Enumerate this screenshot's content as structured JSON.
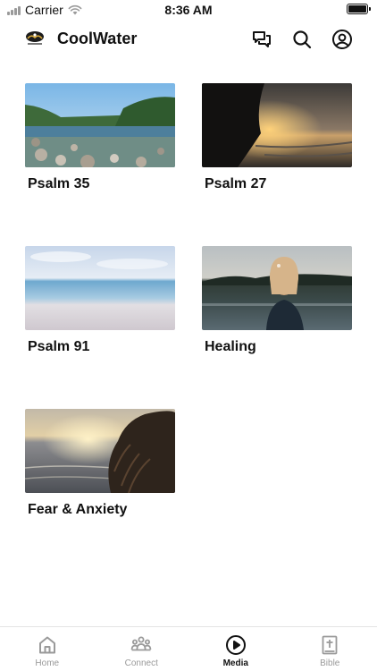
{
  "status_bar": {
    "carrier": "Carrier",
    "time": "8:36 AM"
  },
  "header": {
    "title": "CoolWater",
    "icons": [
      "chat-icon",
      "search-icon",
      "profile-icon"
    ]
  },
  "media": {
    "items": [
      {
        "title": "Psalm 35",
        "image": "rocky-lake-forest"
      },
      {
        "title": "Psalm 27",
        "image": "sunset-beach"
      },
      {
        "title": "Psalm 91",
        "image": "calm-sea-horizon"
      },
      {
        "title": "Healing",
        "image": "person-by-lake"
      },
      {
        "title": "Fear & Anxiety",
        "image": "sea-with-hair"
      }
    ]
  },
  "tab_bar": {
    "tabs": [
      {
        "label": "Home",
        "icon": "home-icon",
        "active": false
      },
      {
        "label": "Connect",
        "icon": "people-icon",
        "active": false
      },
      {
        "label": "Media",
        "icon": "play-circle-icon",
        "active": true
      },
      {
        "label": "Bible",
        "icon": "bible-icon",
        "active": false
      }
    ]
  },
  "colors": {
    "active": "#111111",
    "inactive": "#9a9a9a",
    "background": "#ffffff"
  }
}
